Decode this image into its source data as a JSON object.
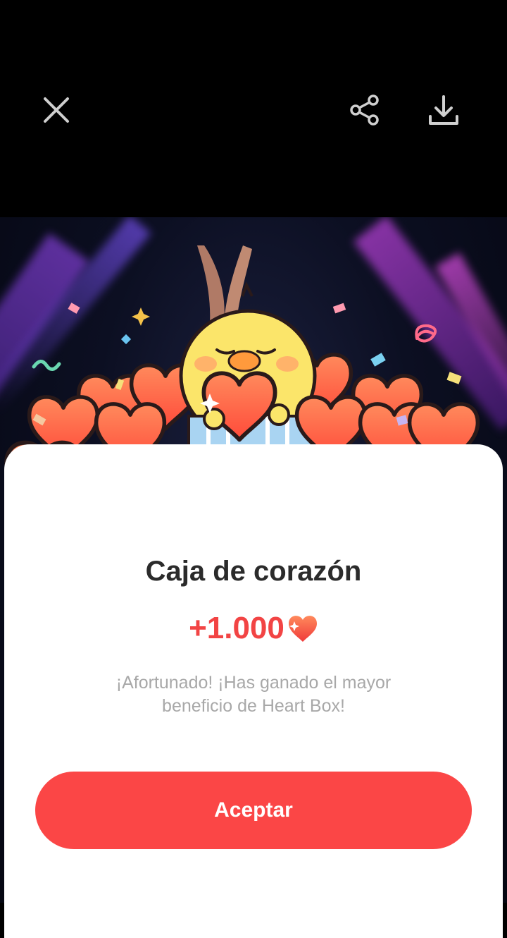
{
  "toolbar": {
    "close_icon": "close-icon",
    "share_icon": "share-icon",
    "download_icon": "download-icon"
  },
  "reward": {
    "title": "Caja de corazón",
    "amount": "+1.000",
    "amount_icon": "heart-icon",
    "description": "¡Afortunado! ¡Has ganado el mayor beneficio de Heart Box!",
    "accept_label": "Aceptar"
  },
  "colors": {
    "accent": "#fb4646",
    "amount": "#f24444",
    "heart": "#ff6446",
    "chick": "#fbe56a"
  }
}
